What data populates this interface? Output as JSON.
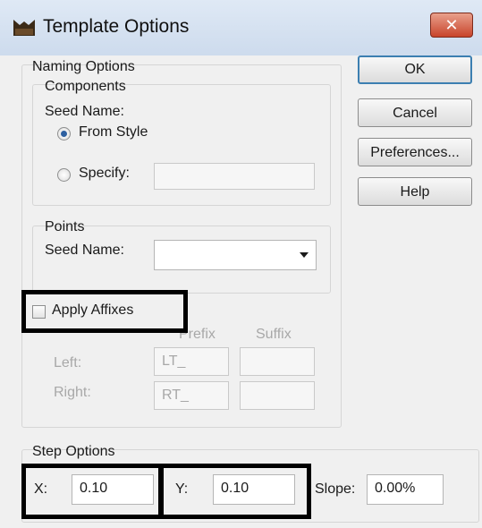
{
  "window": {
    "title": "Template Options",
    "close_label": "✕"
  },
  "buttons": {
    "ok": "OK",
    "cancel": "Cancel",
    "preferences": "Preferences...",
    "help": "Help"
  },
  "naming": {
    "legend": "Naming Options",
    "components": {
      "legend": "Components",
      "seed_label": "Seed Name:",
      "from_style": "From Style",
      "specify": "Specify:",
      "specify_value": "",
      "selected": "From Style"
    },
    "points": {
      "legend": "Points",
      "seed_label": "Seed Name:",
      "seed_value": ""
    },
    "affixes": {
      "apply_label": "Apply Affixes",
      "checked": false,
      "prefix_header": "Prefix",
      "suffix_header": "Suffix",
      "left_label": "Left:",
      "right_label": "Right:",
      "left_prefix": "LT_",
      "right_prefix": "RT_",
      "left_suffix": "",
      "right_suffix": ""
    }
  },
  "step": {
    "legend": "Step Options",
    "x_label": "X:",
    "x_value": "0.10",
    "y_label": "Y:",
    "y_value": "0.10",
    "slope_label": "Slope:",
    "slope_value": "0.00%"
  },
  "colors": {
    "highlight_box": "#000000",
    "title_bar": "#d6e2f0",
    "close_button": "#c8442b"
  }
}
